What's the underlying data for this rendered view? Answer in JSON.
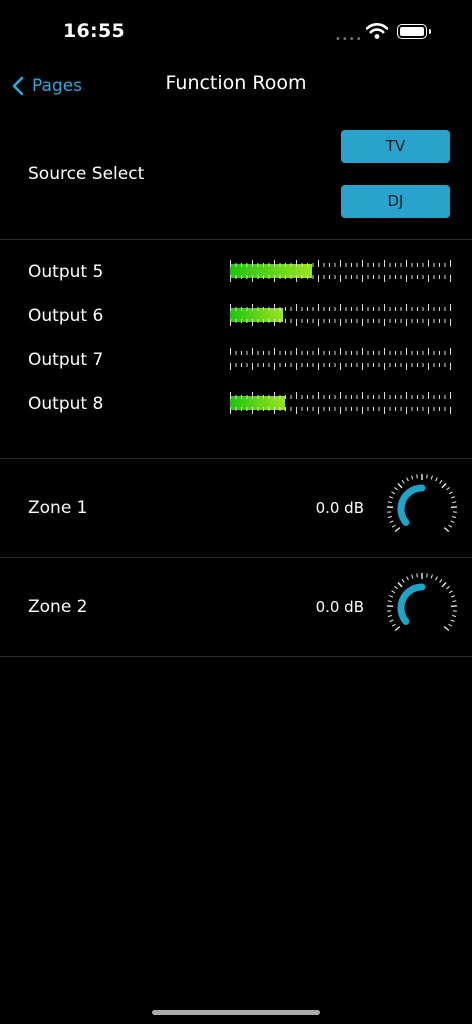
{
  "status": {
    "time": "16:55",
    "signal": "••••"
  },
  "nav": {
    "back_label": "Pages",
    "title": "Function Room"
  },
  "source_select": {
    "label": "Source Select",
    "buttons": [
      "TV",
      "DJ"
    ]
  },
  "outputs": [
    {
      "label": "Output 5",
      "level": 0.37
    },
    {
      "label": "Output 6",
      "level": 0.24
    },
    {
      "label": "Output 7",
      "level": 0.0
    },
    {
      "label": "Output 8",
      "level": 0.25
    }
  ],
  "zones": [
    {
      "label": "Zone 1",
      "value": "0.0 dB"
    },
    {
      "label": "Zone 2",
      "value": "0.0 dB"
    }
  ],
  "colors": {
    "accent": "#29a3cc",
    "back": "#2aa9e0",
    "meter_low": "#1fc40f",
    "meter_high": "#9be51e",
    "knob_arc": "#1fa3c9"
  }
}
